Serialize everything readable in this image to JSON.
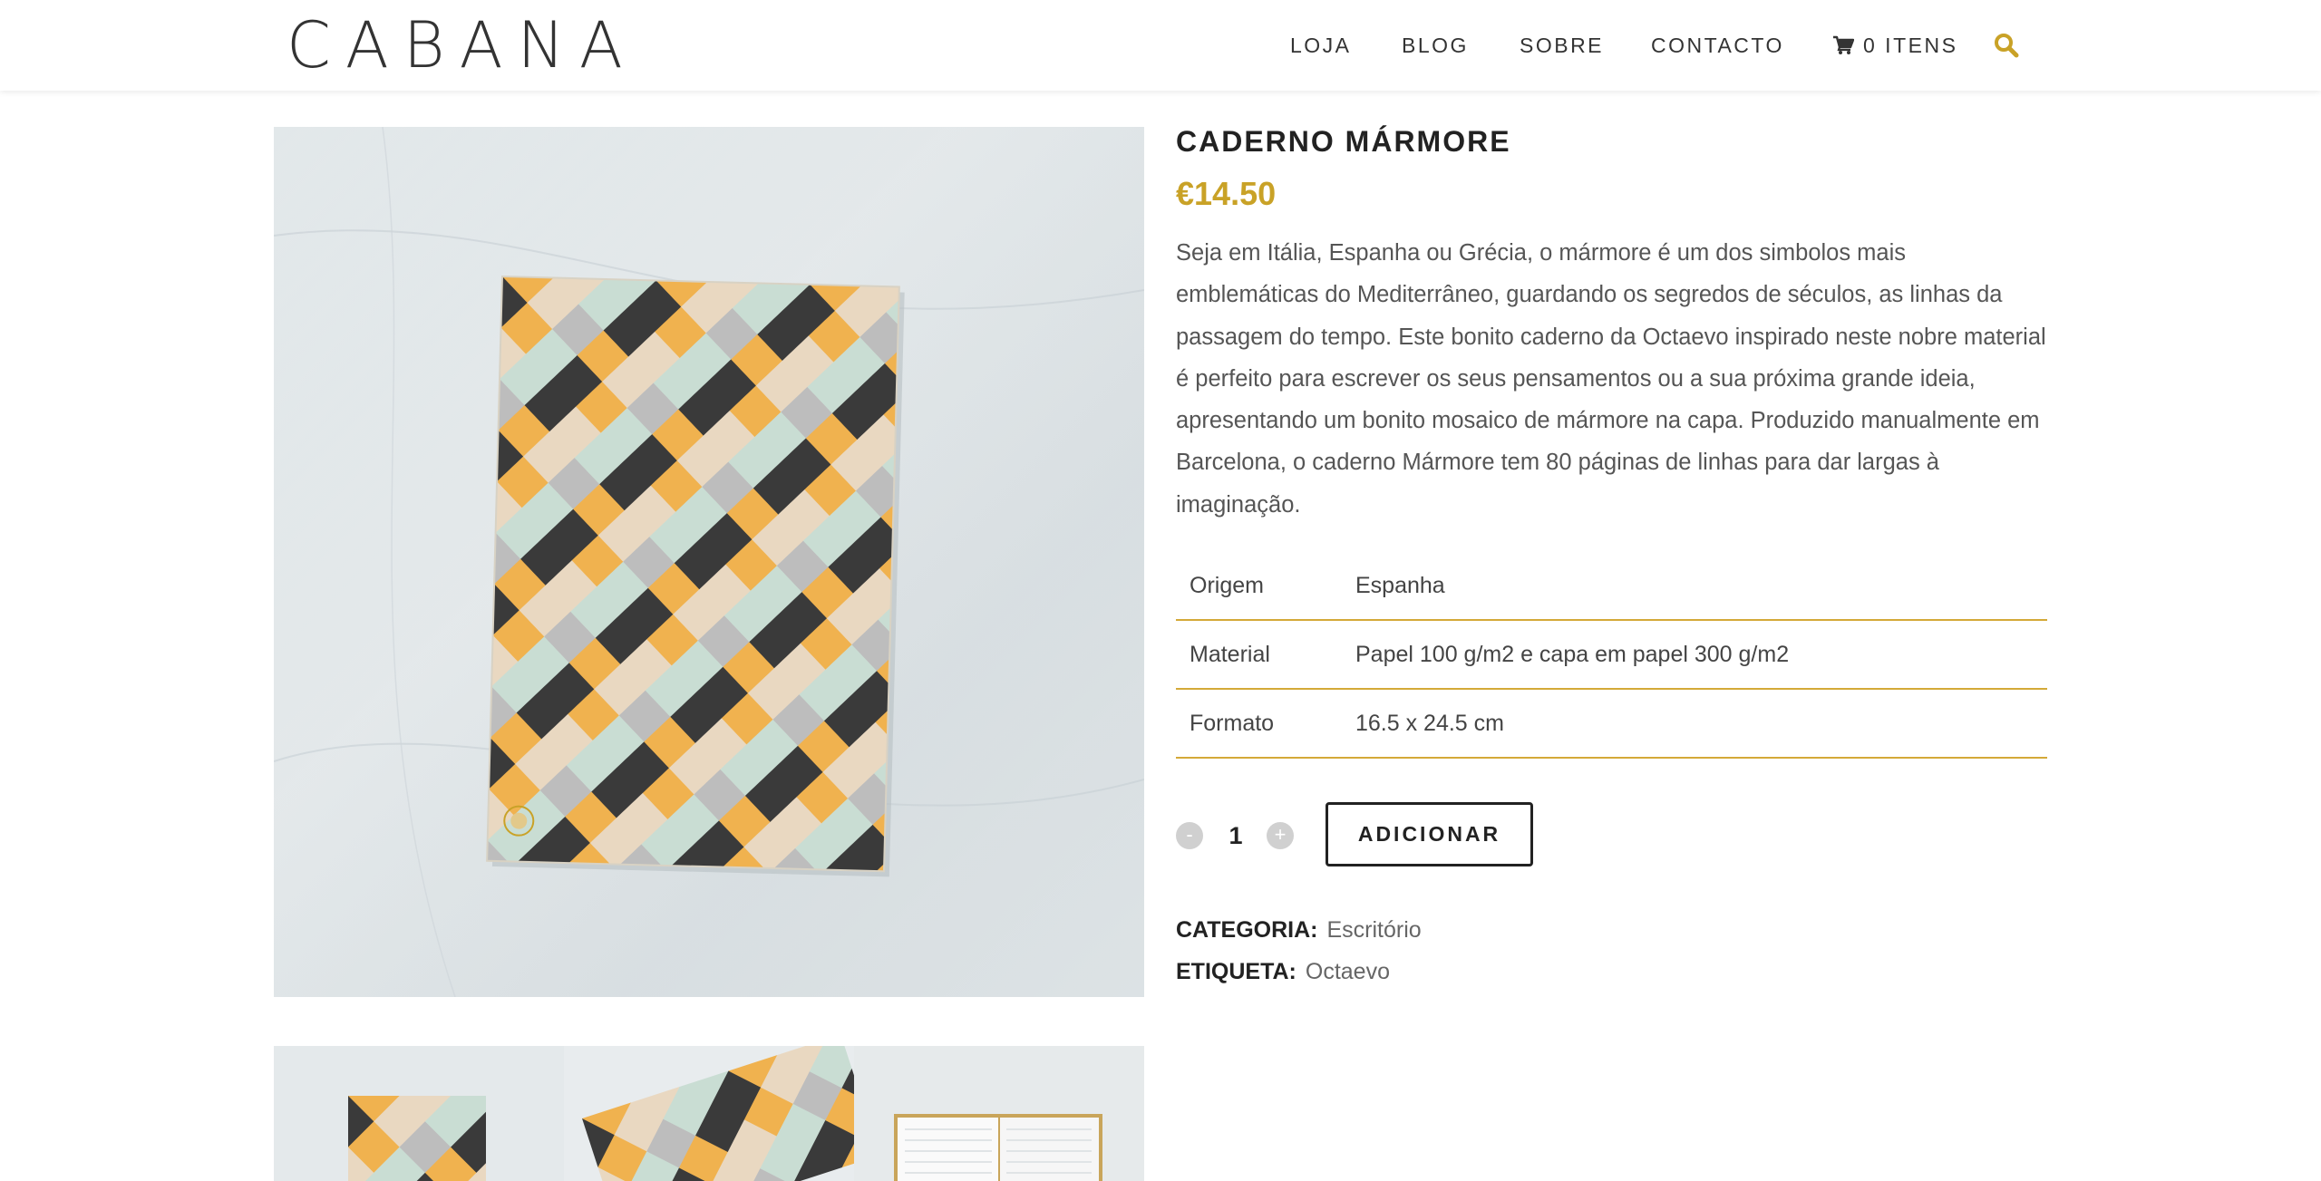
{
  "header": {
    "logo": "CABANA",
    "nav": [
      "LOJA",
      "BLOG",
      "SOBRE",
      "CONTACTO"
    ],
    "cart_label": "0 ITENS",
    "cart_icon": "shopping-cart-icon",
    "search_icon": "search-icon"
  },
  "product": {
    "title": "CADERNO MÁRMORE",
    "price": "€14.50",
    "description": "Seja em Itália, Espanha ou Grécia, o mármore é um dos simbolos mais emblemáticas do Mediterrâneo, guardando os segredos de séculos, as linhas da passagem do tempo. Este bonito caderno da Octaevo inspirado neste nobre material é perfeito para escrever os seus pensamentos ou a sua próxima grande ideia, apresentando um bonito mosaico de mármore na capa. Produzido manualmente em Barcelona, o caderno Mármore tem 80 páginas de linhas para dar largas à imaginação.",
    "attributes": [
      {
        "key": "Origem",
        "value": "Espanha"
      },
      {
        "key": "Material",
        "value": "Papel 100 g/m2 e capa em papel 300 g/m2"
      },
      {
        "key": "Formato",
        "value": "16.5 x 24.5 cm"
      }
    ],
    "quantity": "1",
    "qty_minus": "-",
    "qty_plus": "+",
    "add_button": "ADICIONAR",
    "category_label": "CATEGORIA:",
    "category_value": "Escritório",
    "tag_label": "ETIQUETA:",
    "tag_value": "Octaevo"
  },
  "colors": {
    "accent": "#c9a227",
    "rule": "#d4a938",
    "text_dark": "#222222",
    "marble_bg": "#dfe5e8"
  }
}
